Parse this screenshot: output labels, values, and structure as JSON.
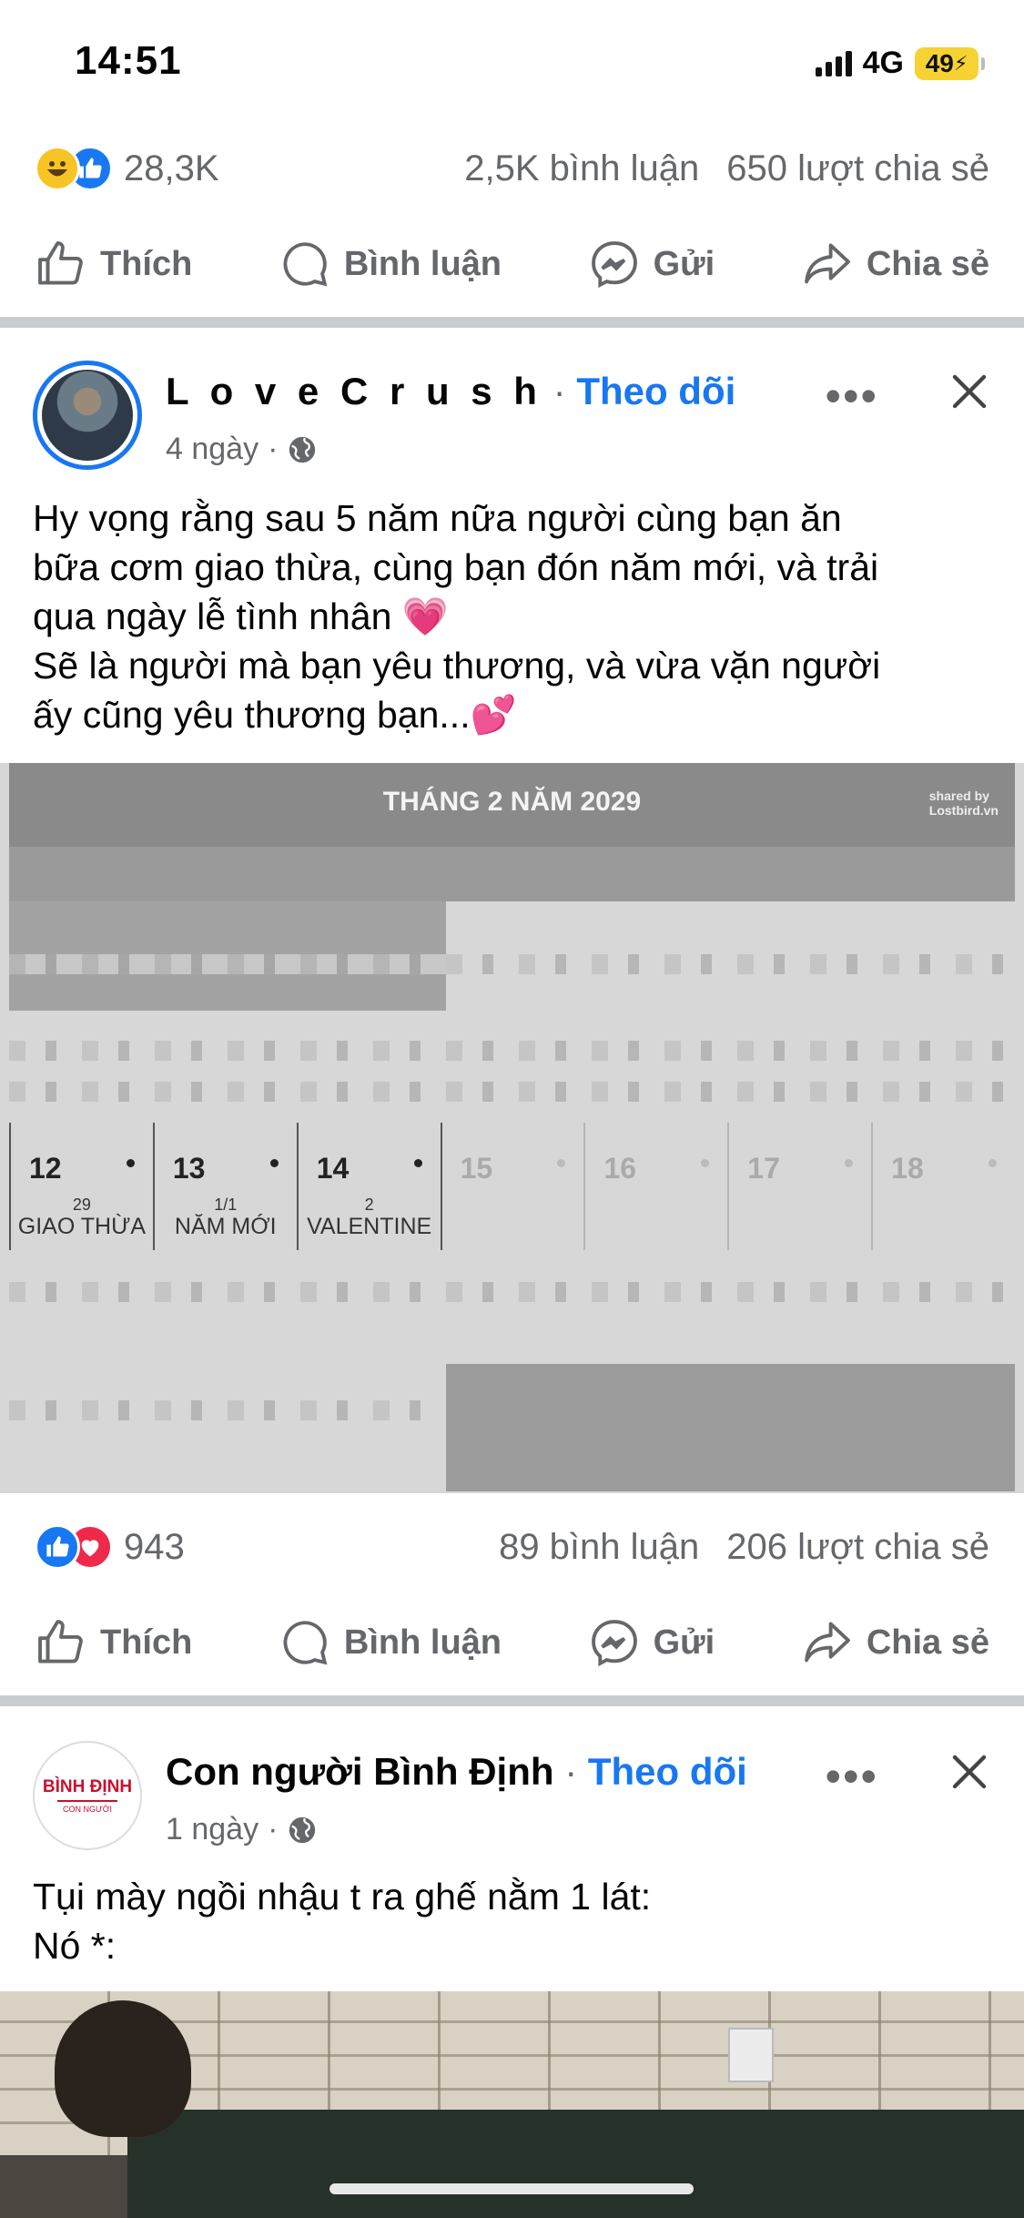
{
  "status_bar": {
    "time": "14:51",
    "network": "4G",
    "battery": "49"
  },
  "top_post": {
    "reaction_count": "28,3K",
    "comments": "2,5K bình luận",
    "shares": "650 lượt chia sẻ"
  },
  "actions": {
    "like": "Thích",
    "comment": "Bình luận",
    "send": "Gửi",
    "share": "Chia sẻ"
  },
  "post1": {
    "author": "L o v e C r u s h",
    "separator": "·",
    "follow": "Theo dõi",
    "time": "4 ngày",
    "text_lines": [
      "Hy vọng rằng sau 5 năm nữa người cùng bạn ăn",
      "bữa cơm giao thừa, cùng bạn đón năm mới, và trải",
      "qua ngày lễ tình nhân 💗",
      "Sẽ là người mà bạn yêu thương, và vừa vặn người",
      "ấy cũng yêu thương bạn...💕"
    ],
    "image": {
      "title": "THÁNG 2 NĂM 2029",
      "logo_line1": "shared by",
      "logo_line2": "Lostbird.vn",
      "days": [
        {
          "day": "12",
          "lunar": "29",
          "event": "GIAO THỪA"
        },
        {
          "day": "13",
          "lunar": "1/1",
          "event": "NĂM MỚI"
        },
        {
          "day": "14",
          "lunar": "2",
          "event": "VALENTINE"
        },
        {
          "day": "15",
          "lunar": "",
          "event": ""
        },
        {
          "day": "16",
          "lunar": "",
          "event": ""
        },
        {
          "day": "17",
          "lunar": "",
          "event": ""
        },
        {
          "day": "18",
          "lunar": "",
          "event": ""
        }
      ]
    },
    "reaction_count": "943",
    "comments": "89 bình luận",
    "shares": "206 lượt chia sẻ"
  },
  "post2": {
    "author": "Con người Bình Định",
    "separator": "·",
    "follow": "Theo dõi",
    "time": "1 ngày",
    "avatar_text": "BÌNH ĐỊNH",
    "avatar_sub": "CON NGƯỜI",
    "text_lines": [
      "Tụi mày ngồi nhậu t ra ghế nằm 1 lát:",
      "Nó *:"
    ]
  },
  "colors": {
    "accent": "#1877f2",
    "divider": "#c9ccd1",
    "secondary_text": "#65676b"
  }
}
